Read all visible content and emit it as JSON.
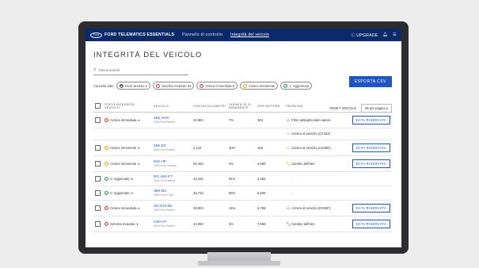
{
  "topbar": {
    "logo": "Ford",
    "brand": "FORD TELEMATICS ESSENTIALS",
    "nav": [
      "Pannello di controllo",
      "Integrità del veicolo"
    ],
    "upgrade": "UPGRADE"
  },
  "page": {
    "title": "INTEGRITÀ DEL VEICOLO",
    "search_placeholder": "Cerca veicoli",
    "export": "ESPORTA CSV",
    "filter_label": "Cancella tutto",
    "filters": [
      {
        "label": "Fuori servizio 2",
        "icon": "car-icon",
        "color": "#555555"
      },
      {
        "label": "Servizio Scaduto 34",
        "icon": "alert-icon",
        "color": "#d33b3b"
      },
      {
        "label": "Azione immediata 9",
        "icon": "alert-icon",
        "color": "#d33b3b"
      },
      {
        "label": "Azione imminente",
        "icon": "warning-icon",
        "color": "#e8a317"
      },
      {
        "label": "V. Aggiornato",
        "icon": "check-icon",
        "color": "#2e9b4f"
      }
    ],
    "reset": "RESET VEICOLO",
    "per_page": "25 per pagina"
  },
  "table": {
    "headers": [
      "STATO INTEGRITÀ VEICOLO",
      "VEICOLO",
      "CONTACHILOMETRI",
      "DURATA OLIO RIMANENTE",
      "ORE MOTORE",
      "PROBLEMI"
    ],
    "rows": [
      {
        "status": "Azione immediata",
        "scolor": "#d33b3b",
        "id": "166 AHO",
        "model": "2016 Ford Transit",
        "km": "10,984",
        "oil": "7%",
        "hours": "343",
        "problem": "Filtro antiparticolato saturo",
        "pcolor": "#d33b3b",
        "button": "DATA RISERVATA"
      },
      {
        "status": "",
        "scolor": "",
        "id": "",
        "model": "",
        "km": "",
        "oil": "",
        "hours": "",
        "problem": "Azzera di servizio (CF342)",
        "pcolor": "#e8a317",
        "button": ""
      },
      {
        "status": "Azione imminente",
        "scolor": "#e8a317",
        "id": "456 DC",
        "model": "2020 Ford Transit",
        "km": "2,124",
        "oil": "40%",
        "hours": "103",
        "problem": "Azzera di servizio (C940D)",
        "pcolor": "#e8a317",
        "button": "DATA RISERVATA"
      },
      {
        "status": "Azione imminente",
        "scolor": "#e8a317",
        "id": "842 HP",
        "model": "2020 Ford Connect",
        "km": "52,254",
        "oil": "4%",
        "hours": "4,080",
        "problem": "Cambio dell'olio",
        "pcolor": "#e8a317",
        "button": "DATA RISERVATA"
      },
      {
        "status": "V. Aggiornato",
        "scolor": "#2e9b4f",
        "id": "RG 450 FT",
        "model": "2016 Ford Transit",
        "km": "34,345",
        "oil": "91%",
        "hours": "4,350",
        "problem": "-",
        "pcolor": "#999999",
        "button": ""
      },
      {
        "status": "V. Aggiornato",
        "scolor": "#2e9b4f",
        "id": "389 MC",
        "model": "2016 Ford F-150",
        "km": "45,710",
        "oil": "69%",
        "hours": "6,509",
        "problem": "-",
        "pcolor": "#999999",
        "button": ""
      },
      {
        "status": "Azione immediata",
        "scolor": "#d33b3b",
        "id": "SD 576 ML",
        "model": "2019 Ford Transit",
        "km": "48,904",
        "oil": "15%",
        "hours": "6,798",
        "problem": "Azzera di servizio (D345F)",
        "pcolor": "#d33b3b",
        "button": "DATA RISERVATA"
      },
      {
        "status": "Servizio Scaduto",
        "scolor": "#d33b3b",
        "id": "C50 HT",
        "model": "2016 Ford Transit",
        "km": "34,050",
        "oil": "5%",
        "hours": "7,569",
        "problem": "Cambio dell'olio",
        "pcolor": "#d33b3b",
        "button": "DATA RISERVATA"
      }
    ]
  }
}
